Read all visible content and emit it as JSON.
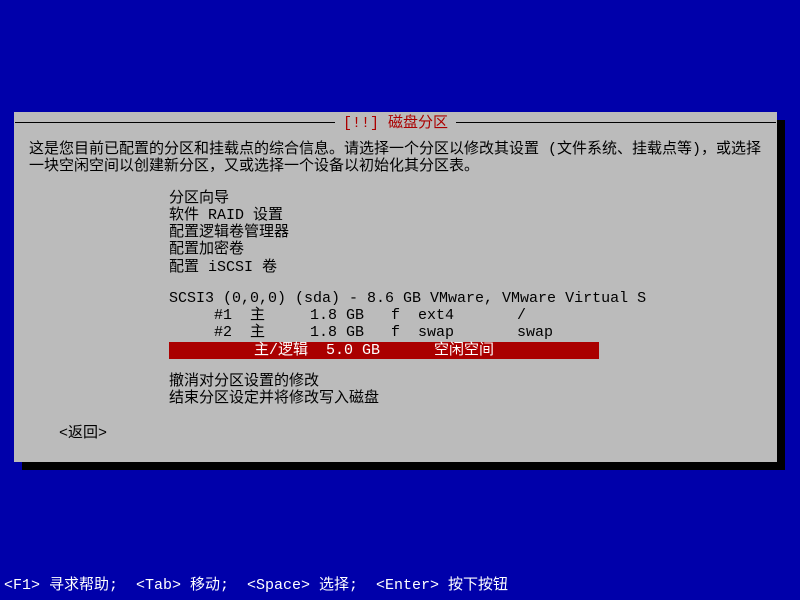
{
  "dialog": {
    "title": "[!!] 磁盘分区",
    "intro": "这是您目前已配置的分区和挂载点的综合信息。请选择一个分区以修改其设置 (文件系统、挂载点等)，或选择一块空闲空间以创建新分区，又或选择一个设备以初始化其分区表。"
  },
  "menu": {
    "items": [
      "分区向导",
      "软件 RAID 设置",
      "配置逻辑卷管理器",
      "配置加密卷",
      "配置 iSCSI 卷"
    ]
  },
  "disk": {
    "header": "SCSI3 (0,0,0) (sda) - 8.6 GB VMware, VMware Virtual S",
    "partitions": [
      "     #1  主     1.8 GB   f  ext4       /",
      "     #2  主     1.8 GB   f  swap       swap",
      "         主/逻辑  5.0 GB      空闲空间"
    ]
  },
  "actions": {
    "undo": "撤消对分区设置的修改",
    "finish": "结束分区设定并将修改写入磁盘"
  },
  "back": "<返回>",
  "footer": "<F1> 寻求帮助;  <Tab> 移动;  <Space> 选择;  <Enter> 按下按钮"
}
